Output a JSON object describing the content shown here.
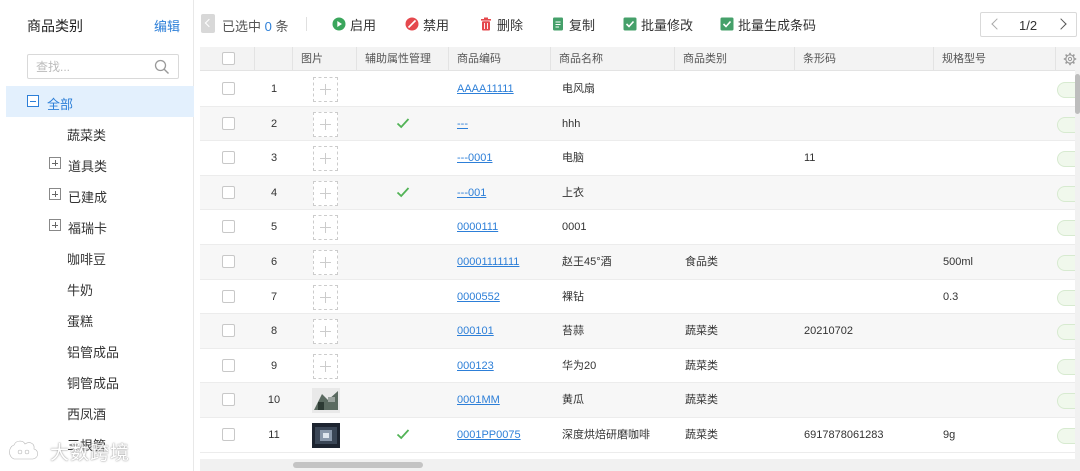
{
  "sidebar": {
    "title": "商品类别",
    "edit_label": "编辑",
    "search_placeholder": "查找...",
    "tree": [
      {
        "label": "全部",
        "toggle": "minus",
        "selected": true
      },
      {
        "label": "蔬菜类",
        "toggle": "none"
      },
      {
        "label": "道具类",
        "toggle": "plus"
      },
      {
        "label": "已建成",
        "toggle": "plus"
      },
      {
        "label": "福瑞卡",
        "toggle": "plus"
      },
      {
        "label": "咖啡豆",
        "toggle": "none"
      },
      {
        "label": "牛奶",
        "toggle": "none"
      },
      {
        "label": "蛋糕",
        "toggle": "none"
      },
      {
        "label": "铝管成品",
        "toggle": "none"
      },
      {
        "label": "铜管成品",
        "toggle": "none"
      },
      {
        "label": "西凤酒",
        "toggle": "none"
      },
      {
        "label": "三根管",
        "toggle": "none"
      }
    ]
  },
  "toolbar": {
    "selected_prefix": "已选中",
    "selected_count": "0",
    "selected_suffix": "条",
    "enable_label": "启用",
    "disable_label": "禁用",
    "delete_label": "删除",
    "copy_label": "复制",
    "batch_edit_label": "批量修改",
    "batch_barcode_label": "批量生成条码",
    "page_indicator": "1/2"
  },
  "colors": {
    "accent": "#2d7fd8",
    "enable_green": "#3aa65c",
    "disable_red": "#e5484d",
    "delete_red": "#e5484d",
    "copy_green": "#45a06a",
    "batch_green": "#45a06a",
    "check_green": "#52b356"
  },
  "table": {
    "columns": [
      "",
      "",
      "图片",
      "辅助属性管理",
      "商品编码",
      "商品名称",
      "商品类别",
      "条形码",
      "规格型号"
    ],
    "rows": [
      {
        "no": "1",
        "image": "placeholder",
        "aux": false,
        "code": "AAAA11111",
        "name": "电风扇",
        "category": "",
        "barcode": "",
        "spec": ""
      },
      {
        "no": "2",
        "image": "placeholder",
        "aux": true,
        "code": "---",
        "name": "hhh",
        "category": "",
        "barcode": "",
        "spec": ""
      },
      {
        "no": "3",
        "image": "placeholder",
        "aux": false,
        "code": "---0001",
        "name": "电脑",
        "category": "",
        "barcode": "11",
        "spec": ""
      },
      {
        "no": "4",
        "image": "placeholder",
        "aux": true,
        "code": "---001",
        "name": "上衣",
        "category": "",
        "barcode": "",
        "spec": ""
      },
      {
        "no": "5",
        "image": "placeholder",
        "aux": false,
        "code": "0000111",
        "name": "0001",
        "category": "",
        "barcode": "",
        "spec": ""
      },
      {
        "no": "6",
        "image": "placeholder",
        "aux": false,
        "code": "00001111111",
        "name": "赵王45°酒",
        "category": "食品类",
        "barcode": "",
        "spec": "500ml"
      },
      {
        "no": "7",
        "image": "placeholder",
        "aux": false,
        "code": "0000552",
        "name": "裸钻",
        "category": "",
        "barcode": "",
        "spec": "0.3"
      },
      {
        "no": "8",
        "image": "placeholder",
        "aux": false,
        "code": "000101",
        "name": "苔蒜",
        "category": "蔬菜类",
        "barcode": "20210702",
        "spec": ""
      },
      {
        "no": "9",
        "image": "placeholder",
        "aux": false,
        "code": "000123",
        "name": "华为20",
        "category": "蔬菜类",
        "barcode": "",
        "spec": ""
      },
      {
        "no": "10",
        "image": "photo-light",
        "aux": false,
        "code": "0001MM",
        "name": "黄瓜",
        "category": "蔬菜类",
        "barcode": "",
        "spec": ""
      },
      {
        "no": "11",
        "image": "photo-dark",
        "aux": true,
        "code": "0001PP0075",
        "name": "深度烘焙研磨咖啡",
        "category": "蔬菜类",
        "barcode": "6917878061283",
        "spec": "9g"
      }
    ]
  },
  "watermark": {
    "text": "大数跨境"
  }
}
